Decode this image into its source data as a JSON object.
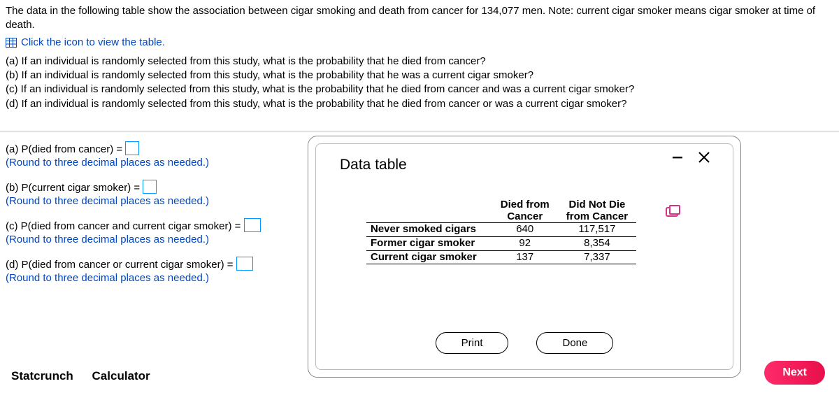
{
  "problem": {
    "intro": "The data in the following table show the association between cigar smoking and death from cancer for 134,077 men. Note: current cigar smoker means cigar smoker at time of death.",
    "view_table_link": "Click the icon to view the table.",
    "parts": {
      "a": "(a) If an individual is randomly selected from this study, what is the probability that he died from cancer?",
      "b": "(b) If an individual is randomly selected from this study, what is the probability that he was a current cigar smoker?",
      "c": "(c) If an individual is randomly selected from this study, what is the probability that he died from cancer and was a current cigar smoker?",
      "d": "(d) If an individual is randomly selected from this study, what is the probability that he died from cancer or was a current cigar smoker?"
    }
  },
  "answers": {
    "a_label": "(a) P(died from cancer) = ",
    "b_label": "(b) P(current cigar smoker) = ",
    "c_label": "(c) P(died from cancer and current cigar smoker) = ",
    "d_label": "(d) P(died from cancer or current cigar smoker) = ",
    "round_hint": "(Round to three decimal places as needed.)"
  },
  "modal": {
    "title": "Data table",
    "print_label": "Print",
    "done_label": "Done"
  },
  "chart_data": {
    "type": "table",
    "columns": [
      "",
      "Died from Cancer",
      "Did Not Die from Cancer"
    ],
    "col1_line1": "Died from",
    "col1_line2": "Cancer",
    "col2_line1": "Did Not Die",
    "col2_line2": "from Cancer",
    "rows": [
      {
        "label": "Never smoked cigars",
        "died": "640",
        "not_died": "117,517"
      },
      {
        "label": "Former cigar smoker",
        "died": "92",
        "not_died": "8,354"
      },
      {
        "label": "Current cigar smoker",
        "died": "137",
        "not_died": "7,337"
      }
    ]
  },
  "tools": {
    "statcrunch": "Statcrunch",
    "calculator": "Calculator"
  },
  "next_label": "Next"
}
